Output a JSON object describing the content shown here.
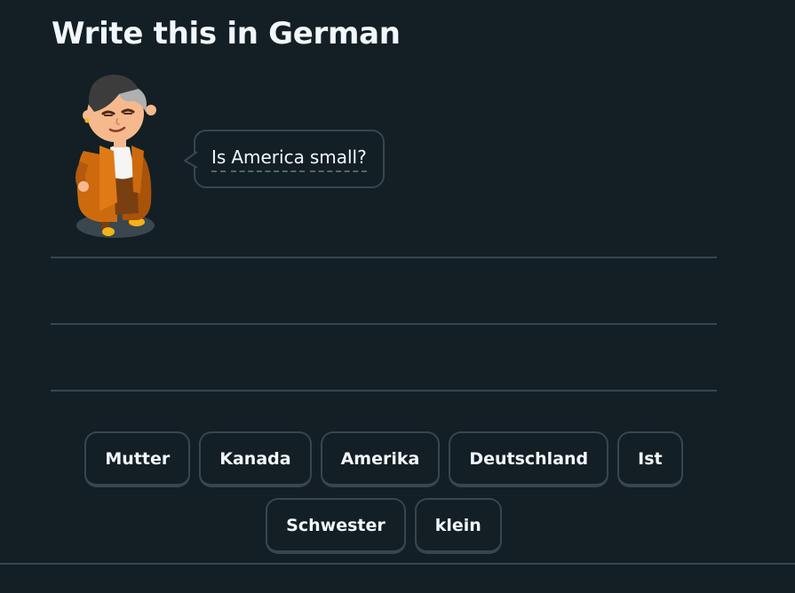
{
  "exercise": {
    "title": "Write this in German"
  },
  "prompt": {
    "words": [
      "Is",
      "America",
      "small?"
    ]
  },
  "word_bank": {
    "row1": [
      "Mutter",
      "Kanada",
      "Amerika",
      "Deutschland",
      "Ist"
    ],
    "row2": [
      "Schwester",
      "klein"
    ]
  },
  "colors": {
    "background": "#131f24",
    "border": "#37464f",
    "text": "#f1f7fb",
    "character_coat": "#cd6a0e"
  },
  "icons": {
    "character": "duolingo-lily-character-icon"
  }
}
